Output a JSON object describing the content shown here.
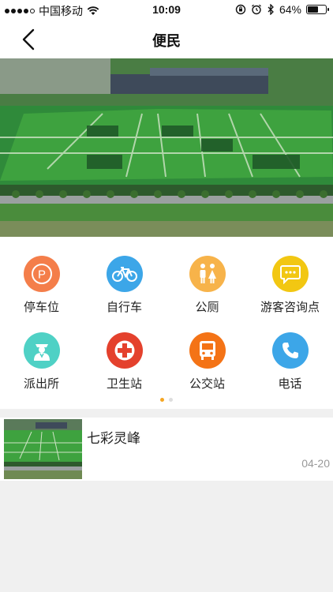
{
  "status_bar": {
    "carrier": "中国移动",
    "time": "10:09",
    "battery_percent": "64%",
    "battery_level": 0.64
  },
  "nav": {
    "title": "便民"
  },
  "services": [
    {
      "label": "停车位",
      "icon": "parking-icon",
      "color": "#f47e4a"
    },
    {
      "label": "自行车",
      "icon": "bicycle-icon",
      "color": "#3ca6e8"
    },
    {
      "label": "公厕",
      "icon": "restroom-icon",
      "color": "#f7b34a"
    },
    {
      "label": "游客咨询点",
      "icon": "chat-icon",
      "color": "#f2c712"
    },
    {
      "label": "派出所",
      "icon": "police-icon",
      "color": "#4fd1c5"
    },
    {
      "label": "卫生站",
      "icon": "medical-cross-icon",
      "color": "#e4412d"
    },
    {
      "label": "公交站",
      "icon": "bus-icon",
      "color": "#f47316"
    },
    {
      "label": "电话",
      "icon": "phone-icon",
      "color": "#3ca6e8"
    }
  ],
  "pager": {
    "pages": 2,
    "active": 0
  },
  "news": [
    {
      "title": "七彩灵峰",
      "date": "04-20"
    }
  ],
  "colors": {
    "active_dot": "#f5a623",
    "page_bg": "#f0f0f0"
  }
}
